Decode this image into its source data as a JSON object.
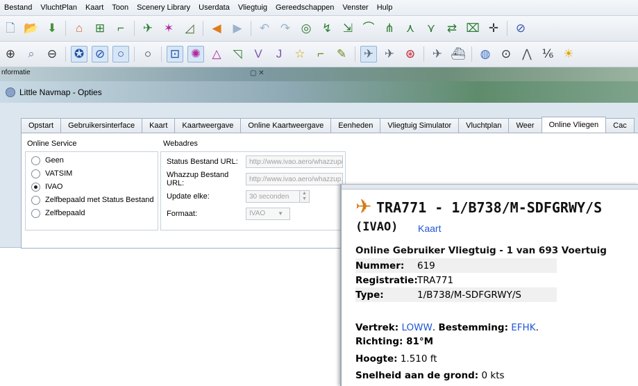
{
  "menubar": [
    "Bestand",
    "VluchtPlan",
    "Kaart",
    "Toon",
    "Scenery Library",
    "Userdata",
    "Vliegtuig",
    "Gereedschappen",
    "Venster",
    "Hulp"
  ],
  "infobar": {
    "label": "nformatie",
    "window_buttons": "▢ ✕"
  },
  "dialog": {
    "title": "Little Navmap - Opties",
    "tabs": [
      "Opstart",
      "Gebruikersinterface",
      "Kaart",
      "Kaartweergave",
      "Online Kaartweergave",
      "Eenheden",
      "Vliegtuig Simulator",
      "Vluchtplan",
      "Weer",
      "Online Vliegen",
      "Cac"
    ],
    "active_tab": "Online Vliegen",
    "online_service": {
      "title": "Online Service",
      "options": [
        "Geen",
        "VATSIM",
        "IVAO",
        "Zelfbepaald met Status Bestand",
        "Zelfbepaald"
      ],
      "selected": "IVAO"
    },
    "webadres": {
      "title": "Webadres",
      "status_label": "Status Bestand URL:",
      "status_value": "http://www.ivao.aero/whazzup/status.txt",
      "whazzup_label": "Whazzup Bestand URL:",
      "whazzup_value": "http://www.ivao.aero/whazzup.txt",
      "update_label": "Update elke:",
      "update_value": "30 seconden",
      "format_label": "Formaat:",
      "format_value": "IVAO"
    }
  },
  "popup": {
    "title_line1": "TRA771 - 1/B738/M-SDFGRWY/S",
    "title_line2": "(IVAO)",
    "map_link": "Kaart",
    "section": "Online Gebruiker Vliegtuig - 1 van 693 Voertuig",
    "rows": [
      {
        "key": "Nummer:",
        "value": "619"
      },
      {
        "key": "Registratie:",
        "value": "TRA771"
      },
      {
        "key": "Type:",
        "value": "1/B738/M-SDFGRWY/S"
      }
    ],
    "departure_label": "Vertrek:",
    "departure": "LOWW",
    "destination_label": "Bestemming:",
    "destination": "EFHK",
    "heading_label": "Richting:",
    "heading": "81°M",
    "altitude_label": "Hoogte:",
    "altitude": "1.510 ft",
    "groundspeed_label": "Snelheid aan de grond:",
    "groundspeed": "0 kts"
  }
}
